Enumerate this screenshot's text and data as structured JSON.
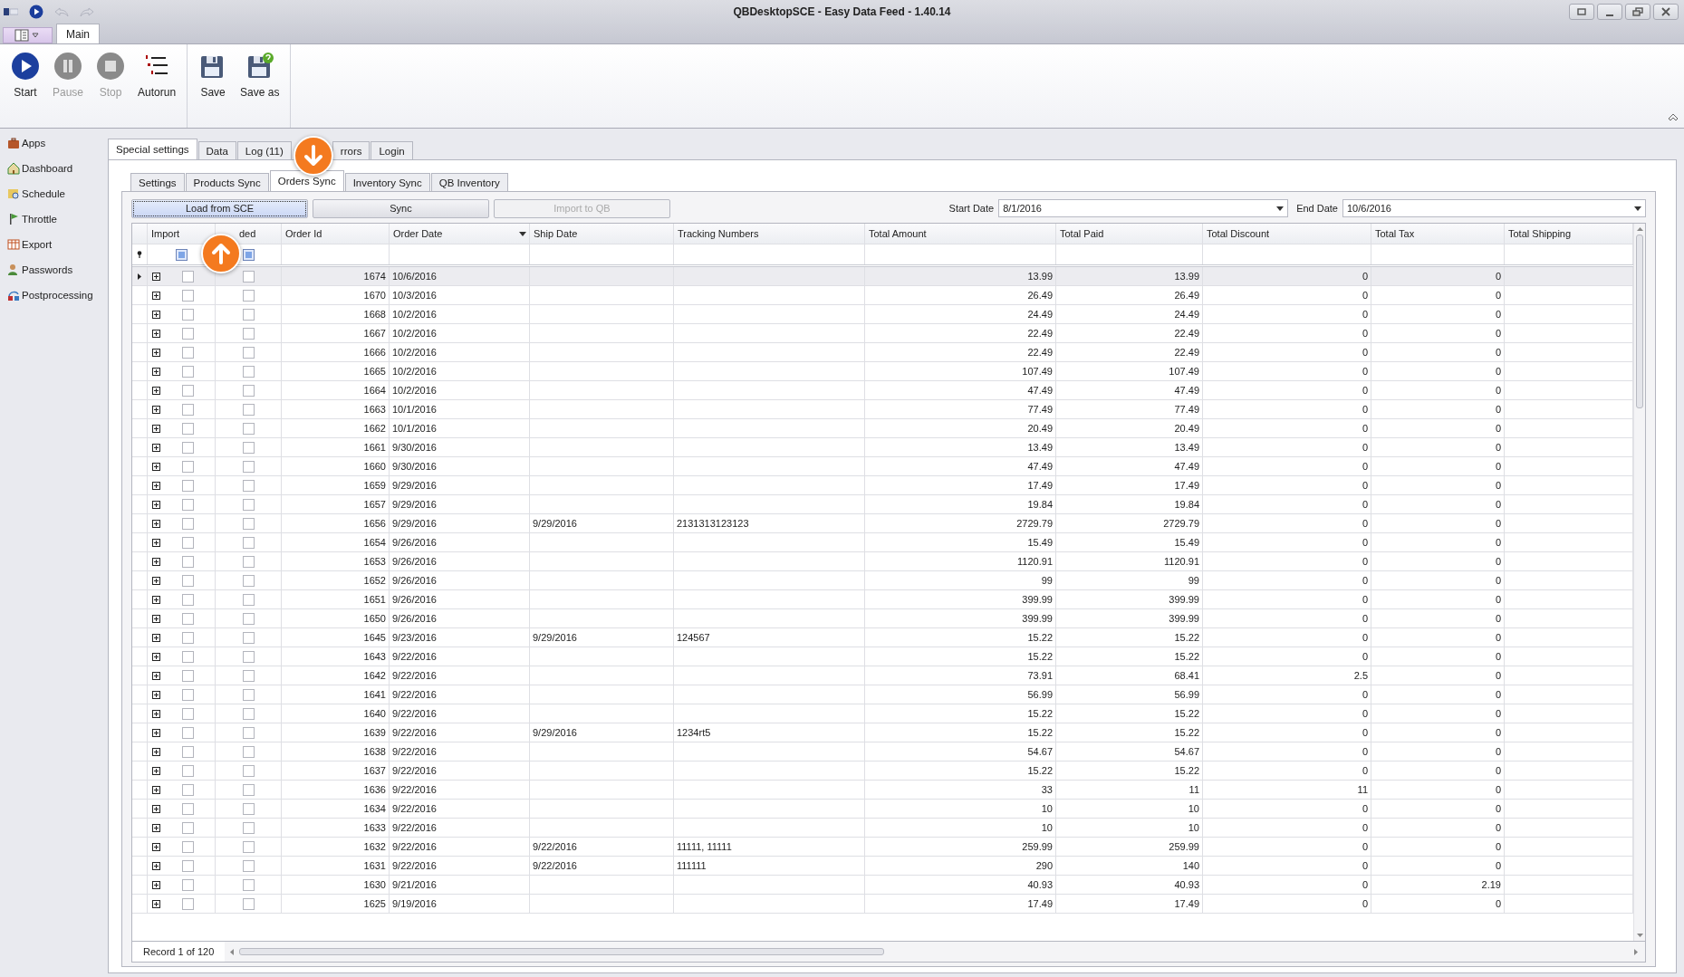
{
  "window": {
    "title": "QBDesktopSCE - Easy Data Feed - 1.40.14"
  },
  "ribbon": {
    "tabs": [
      {
        "label": "Main",
        "selected": true
      }
    ],
    "buttons": [
      {
        "label": "Start",
        "kind": "start",
        "disabled": false
      },
      {
        "label": "Pause",
        "kind": "pause",
        "disabled": true
      },
      {
        "label": "Stop",
        "kind": "stop",
        "disabled": true
      },
      {
        "label": "Autorun",
        "kind": "autorun",
        "disabled": false
      },
      {
        "label": "Save",
        "kind": "save",
        "disabled": false
      },
      {
        "label": "Save as",
        "kind": "saveas",
        "disabled": false
      }
    ]
  },
  "sidebar": {
    "items": [
      {
        "label": "Apps",
        "kind": "apps"
      },
      {
        "label": "Dashboard",
        "kind": "dashboard"
      },
      {
        "label": "Schedule",
        "kind": "schedule"
      },
      {
        "label": "Throttle",
        "kind": "throttle"
      },
      {
        "label": "Export",
        "kind": "export"
      },
      {
        "label": "Passwords",
        "kind": "passwords"
      },
      {
        "label": "Postprocessing",
        "kind": "postprocessing"
      }
    ]
  },
  "tabs": [
    {
      "label": "Special settings",
      "selected": true
    },
    {
      "label": "Data",
      "selected": false
    },
    {
      "label": "Log (11)",
      "selected": false
    },
    {
      "label": "rrors",
      "selected": false
    },
    {
      "label": "Login",
      "selected": false
    }
  ],
  "subtabs": [
    {
      "label": "Settings",
      "selected": false
    },
    {
      "label": "Products Sync",
      "selected": false
    },
    {
      "label": "Orders Sync",
      "selected": true
    },
    {
      "label": "Inventory Sync",
      "selected": false
    },
    {
      "label": "QB Inventory",
      "selected": false
    }
  ],
  "toolbar": {
    "buttons": [
      {
        "label": "Load from SCE",
        "disabled": false,
        "focused": true
      },
      {
        "label": "Sync",
        "disabled": false,
        "focused": false
      },
      {
        "label": "Import to QB",
        "disabled": true,
        "focused": false
      }
    ],
    "start_date": {
      "label": "Start Date",
      "value": "8/1/2016"
    },
    "end_date": {
      "label": "End Date",
      "value": "10/6/2016"
    }
  },
  "table": {
    "select_all": [
      {
        "checked": true
      },
      {
        "checked": true
      }
    ],
    "columns": [
      "Import",
      "ded",
      "Order Id",
      "Order Date",
      "Ship Date",
      "Tracking Numbers",
      "Total Amount",
      "Total Paid",
      "Total Discount",
      "Total Tax",
      "Total Shipping"
    ],
    "rows": [
      {
        "selected": true,
        "import": false,
        "loaded": false,
        "id": "1674",
        "date": "10/6/2016",
        "ship": "",
        "tracking": "",
        "amount": "13.99",
        "paid": "13.99",
        "discount": "0",
        "tax": "0"
      },
      {
        "selected": false,
        "import": false,
        "loaded": false,
        "id": "1670",
        "date": "10/3/2016",
        "ship": "",
        "tracking": "",
        "amount": "26.49",
        "paid": "26.49",
        "discount": "0",
        "tax": "0"
      },
      {
        "selected": false,
        "import": false,
        "loaded": false,
        "id": "1668",
        "date": "10/2/2016",
        "ship": "",
        "tracking": "",
        "amount": "24.49",
        "paid": "24.49",
        "discount": "0",
        "tax": "0"
      },
      {
        "selected": false,
        "import": false,
        "loaded": false,
        "id": "1667",
        "date": "10/2/2016",
        "ship": "",
        "tracking": "",
        "amount": "22.49",
        "paid": "22.49",
        "discount": "0",
        "tax": "0"
      },
      {
        "selected": false,
        "import": false,
        "loaded": false,
        "id": "1666",
        "date": "10/2/2016",
        "ship": "",
        "tracking": "",
        "amount": "22.49",
        "paid": "22.49",
        "discount": "0",
        "tax": "0"
      },
      {
        "selected": false,
        "import": false,
        "loaded": false,
        "id": "1665",
        "date": "10/2/2016",
        "ship": "",
        "tracking": "",
        "amount": "107.49",
        "paid": "107.49",
        "discount": "0",
        "tax": "0"
      },
      {
        "selected": false,
        "import": false,
        "loaded": false,
        "id": "1664",
        "date": "10/2/2016",
        "ship": "",
        "tracking": "",
        "amount": "47.49",
        "paid": "47.49",
        "discount": "0",
        "tax": "0"
      },
      {
        "selected": false,
        "import": false,
        "loaded": false,
        "id": "1663",
        "date": "10/1/2016",
        "ship": "",
        "tracking": "",
        "amount": "77.49",
        "paid": "77.49",
        "discount": "0",
        "tax": "0"
      },
      {
        "selected": false,
        "import": false,
        "loaded": false,
        "id": "1662",
        "date": "10/1/2016",
        "ship": "",
        "tracking": "",
        "amount": "20.49",
        "paid": "20.49",
        "discount": "0",
        "tax": "0"
      },
      {
        "selected": false,
        "import": false,
        "loaded": false,
        "id": "1661",
        "date": "9/30/2016",
        "ship": "",
        "tracking": "",
        "amount": "13.49",
        "paid": "13.49",
        "discount": "0",
        "tax": "0"
      },
      {
        "selected": false,
        "import": false,
        "loaded": false,
        "id": "1660",
        "date": "9/30/2016",
        "ship": "",
        "tracking": "",
        "amount": "47.49",
        "paid": "47.49",
        "discount": "0",
        "tax": "0"
      },
      {
        "selected": false,
        "import": false,
        "loaded": false,
        "id": "1659",
        "date": "9/29/2016",
        "ship": "",
        "tracking": "",
        "amount": "17.49",
        "paid": "17.49",
        "discount": "0",
        "tax": "0"
      },
      {
        "selected": false,
        "import": false,
        "loaded": false,
        "id": "1657",
        "date": "9/29/2016",
        "ship": "",
        "tracking": "",
        "amount": "19.84",
        "paid": "19.84",
        "discount": "0",
        "tax": "0"
      },
      {
        "selected": false,
        "import": false,
        "loaded": false,
        "id": "1656",
        "date": "9/29/2016",
        "ship": "9/29/2016",
        "tracking": "2131313123123",
        "amount": "2729.79",
        "paid": "2729.79",
        "discount": "0",
        "tax": "0"
      },
      {
        "selected": false,
        "import": false,
        "loaded": false,
        "id": "1654",
        "date": "9/26/2016",
        "ship": "",
        "tracking": "",
        "amount": "15.49",
        "paid": "15.49",
        "discount": "0",
        "tax": "0"
      },
      {
        "selected": false,
        "import": false,
        "loaded": false,
        "id": "1653",
        "date": "9/26/2016",
        "ship": "",
        "tracking": "",
        "amount": "1120.91",
        "paid": "1120.91",
        "discount": "0",
        "tax": "0"
      },
      {
        "selected": false,
        "import": false,
        "loaded": false,
        "id": "1652",
        "date": "9/26/2016",
        "ship": "",
        "tracking": "",
        "amount": "99",
        "paid": "99",
        "discount": "0",
        "tax": "0"
      },
      {
        "selected": false,
        "import": false,
        "loaded": false,
        "id": "1651",
        "date": "9/26/2016",
        "ship": "",
        "tracking": "",
        "amount": "399.99",
        "paid": "399.99",
        "discount": "0",
        "tax": "0"
      },
      {
        "selected": false,
        "import": false,
        "loaded": false,
        "id": "1650",
        "date": "9/26/2016",
        "ship": "",
        "tracking": "",
        "amount": "399.99",
        "paid": "399.99",
        "discount": "0",
        "tax": "0"
      },
      {
        "selected": false,
        "import": false,
        "loaded": false,
        "id": "1645",
        "date": "9/23/2016",
        "ship": "9/29/2016",
        "tracking": "124567",
        "amount": "15.22",
        "paid": "15.22",
        "discount": "0",
        "tax": "0"
      },
      {
        "selected": false,
        "import": false,
        "loaded": false,
        "id": "1643",
        "date": "9/22/2016",
        "ship": "",
        "tracking": "",
        "amount": "15.22",
        "paid": "15.22",
        "discount": "0",
        "tax": "0"
      },
      {
        "selected": false,
        "import": false,
        "loaded": false,
        "id": "1642",
        "date": "9/22/2016",
        "ship": "",
        "tracking": "",
        "amount": "73.91",
        "paid": "68.41",
        "discount": "2.5",
        "tax": "0"
      },
      {
        "selected": false,
        "import": false,
        "loaded": false,
        "id": "1641",
        "date": "9/22/2016",
        "ship": "",
        "tracking": "",
        "amount": "56.99",
        "paid": "56.99",
        "discount": "0",
        "tax": "0"
      },
      {
        "selected": false,
        "import": false,
        "loaded": false,
        "id": "1640",
        "date": "9/22/2016",
        "ship": "",
        "tracking": "",
        "amount": "15.22",
        "paid": "15.22",
        "discount": "0",
        "tax": "0"
      },
      {
        "selected": false,
        "import": false,
        "loaded": false,
        "id": "1639",
        "date": "9/22/2016",
        "ship": "9/29/2016",
        "tracking": "1234rt5",
        "amount": "15.22",
        "paid": "15.22",
        "discount": "0",
        "tax": "0"
      },
      {
        "selected": false,
        "import": false,
        "loaded": false,
        "id": "1638",
        "date": "9/22/2016",
        "ship": "",
        "tracking": "",
        "amount": "54.67",
        "paid": "54.67",
        "discount": "0",
        "tax": "0"
      },
      {
        "selected": false,
        "import": false,
        "loaded": false,
        "id": "1637",
        "date": "9/22/2016",
        "ship": "",
        "tracking": "",
        "amount": "15.22",
        "paid": "15.22",
        "discount": "0",
        "tax": "0"
      },
      {
        "selected": false,
        "import": false,
        "loaded": false,
        "id": "1636",
        "date": "9/22/2016",
        "ship": "",
        "tracking": "",
        "amount": "33",
        "paid": "11",
        "discount": "11",
        "tax": "0"
      },
      {
        "selected": false,
        "import": false,
        "loaded": false,
        "id": "1634",
        "date": "9/22/2016",
        "ship": "",
        "tracking": "",
        "amount": "10",
        "paid": "10",
        "discount": "0",
        "tax": "0"
      },
      {
        "selected": false,
        "import": false,
        "loaded": false,
        "id": "1633",
        "date": "9/22/2016",
        "ship": "",
        "tracking": "",
        "amount": "10",
        "paid": "10",
        "discount": "0",
        "tax": "0"
      },
      {
        "selected": false,
        "import": false,
        "loaded": false,
        "id": "1632",
        "date": "9/22/2016",
        "ship": "9/22/2016",
        "tracking": "11111, 11111",
        "amount": "259.99",
        "paid": "259.99",
        "discount": "0",
        "tax": "0"
      },
      {
        "selected": false,
        "import": false,
        "loaded": false,
        "id": "1631",
        "date": "9/22/2016",
        "ship": "9/22/2016",
        "tracking": "111111",
        "amount": "290",
        "paid": "140",
        "discount": "0",
        "tax": "0"
      },
      {
        "selected": false,
        "import": false,
        "loaded": false,
        "id": "1630",
        "date": "9/21/2016",
        "ship": "",
        "tracking": "",
        "amount": "40.93",
        "paid": "40.93",
        "discount": "0",
        "tax": "2.19"
      },
      {
        "selected": false,
        "import": false,
        "loaded": false,
        "id": "1625",
        "date": "9/19/2016",
        "ship": "",
        "tracking": "",
        "amount": "17.49",
        "paid": "17.49",
        "discount": "0",
        "tax": "0"
      }
    ],
    "footer": "Record 1 of 120"
  }
}
